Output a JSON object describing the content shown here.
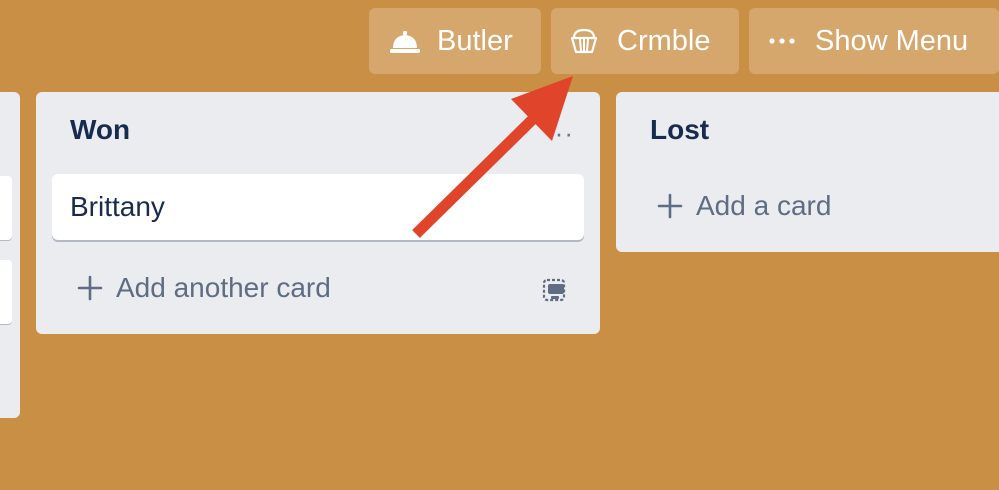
{
  "header": {
    "butler_label": "Butler",
    "crmble_label": "Crmble",
    "menu_label": "Show Menu",
    "menu_icon_glyph": "···"
  },
  "lists": {
    "won": {
      "title": "Won",
      "menu_glyph": "··",
      "cards": [
        "Brittany"
      ],
      "add_label": "Add another card"
    },
    "lost": {
      "title": "Lost",
      "add_label": "Add a card"
    }
  },
  "icons": {
    "butler": "bell-icon",
    "crmble": "muffin-icon",
    "menu": "ellipsis-icon",
    "add": "plus-icon",
    "template": "card-template-icon"
  },
  "colors": {
    "board_background": "#C98F44",
    "list_background": "#EBECF0",
    "title_text": "#172B4D",
    "secondary_text": "#5E6C84",
    "annotation_arrow": "#E0442B"
  }
}
